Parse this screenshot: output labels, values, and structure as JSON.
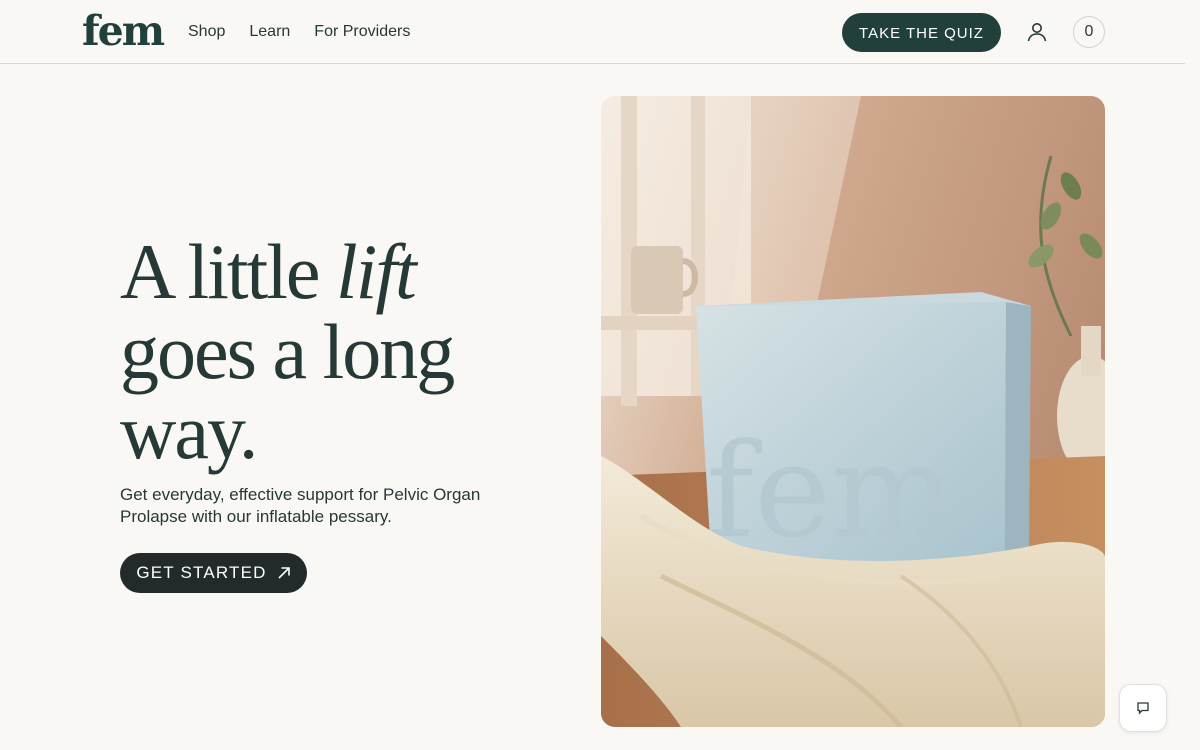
{
  "header": {
    "logo": "fem",
    "nav": [
      "Shop",
      "Learn",
      "For Providers"
    ],
    "quiz_label": "TAKE THE QUIZ",
    "account_icon": "user-icon",
    "cart_count": "0"
  },
  "hero": {
    "headline_part1": "A little ",
    "headline_emphasis": "lift",
    "headline_part2": "goes a long way.",
    "subtext": "Get everyday, effective support for Pelvic Organ Prolapse with our inflatable pessary.",
    "cta_label": "GET STARTED",
    "cta_icon": "arrow-up-right-icon",
    "image": {
      "box_brand": "fem"
    }
  },
  "chat": {
    "icon": "chat-bubble-icon"
  },
  "colors": {
    "brand": "#22403b",
    "background": "#faf8f5",
    "cta": "#222a2b"
  }
}
